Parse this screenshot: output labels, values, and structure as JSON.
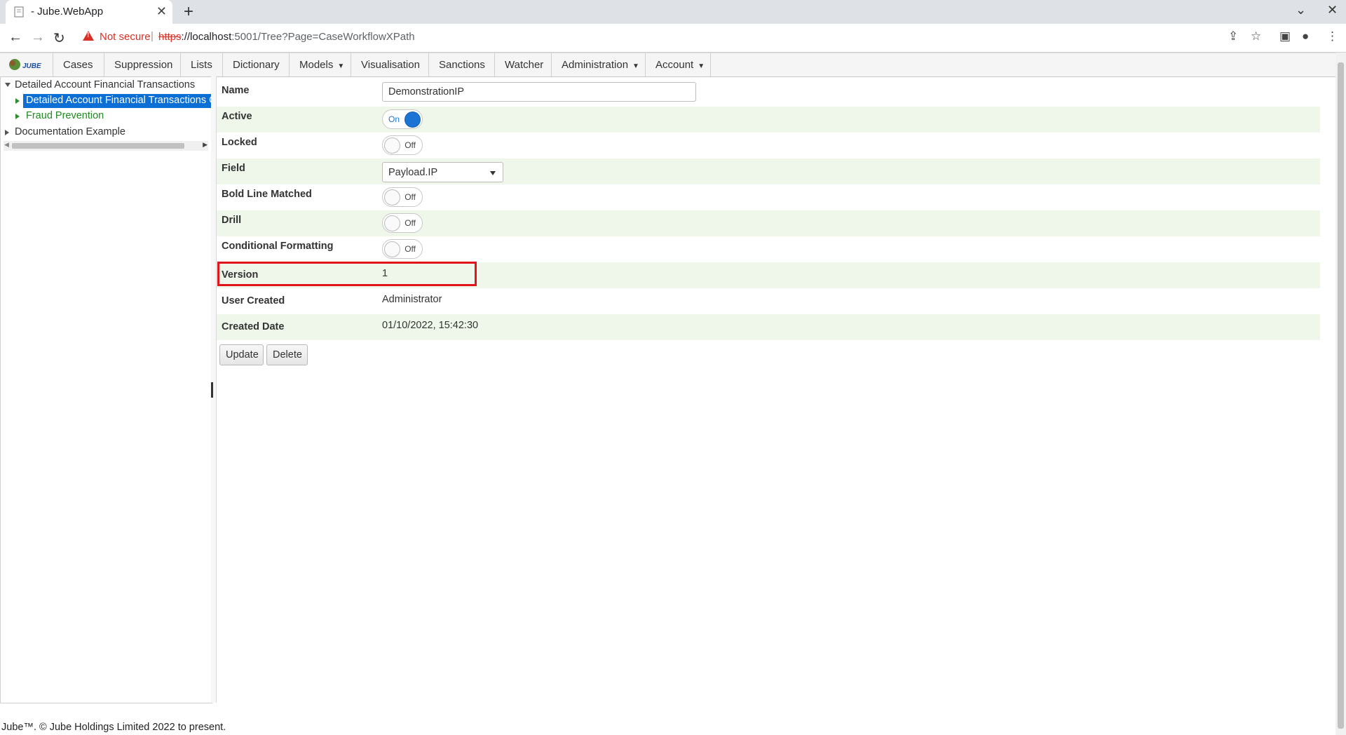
{
  "browser": {
    "tab_title": "- Jube.WebApp",
    "not_secure": "Not secure",
    "url_scheme": "https",
    "url_host": "://localhost",
    "url_rest": ":5001/Tree?Page=CaseWorkflowXPath"
  },
  "menu": {
    "logo_text": "JUBE",
    "items": [
      "Cases",
      "Suppression",
      "Lists",
      "Dictionary",
      "Models",
      "Visualisation",
      "Sanctions",
      "Watcher",
      "Administration",
      "Account"
    ]
  },
  "tree": {
    "root": "Detailed Account Financial Transactions",
    "selected": "Detailed Account Financial Transactions C",
    "child2": "Fraud Prevention",
    "root2": "Documentation Example"
  },
  "form": {
    "name_label": "Name",
    "name_value": "DemonstrationIP",
    "active_label": "Active",
    "active_state": "On",
    "locked_label": "Locked",
    "locked_state": "Off",
    "field_label": "Field",
    "field_value": "Payload.IP",
    "bold_label": "Bold Line Matched",
    "bold_state": "Off",
    "drill_label": "Drill",
    "drill_state": "Off",
    "cond_label": "Conditional Formatting",
    "cond_state": "Off",
    "version_label": "Version",
    "version_value": "1",
    "user_label": "User Created",
    "user_value": "Administrator",
    "date_label": "Created Date",
    "date_value": "01/10/2022, 15:42:30",
    "update_button": "Update",
    "delete_button": "Delete"
  },
  "footer": "Jube™. © Jube Holdings Limited 2022 to present.",
  "colors": {
    "accent": "#1b73d3",
    "selected": "#0b6fd6",
    "alt_row": "#eef7ea",
    "highlight": "#e0151b",
    "tree_green": "#2e8b2e"
  }
}
